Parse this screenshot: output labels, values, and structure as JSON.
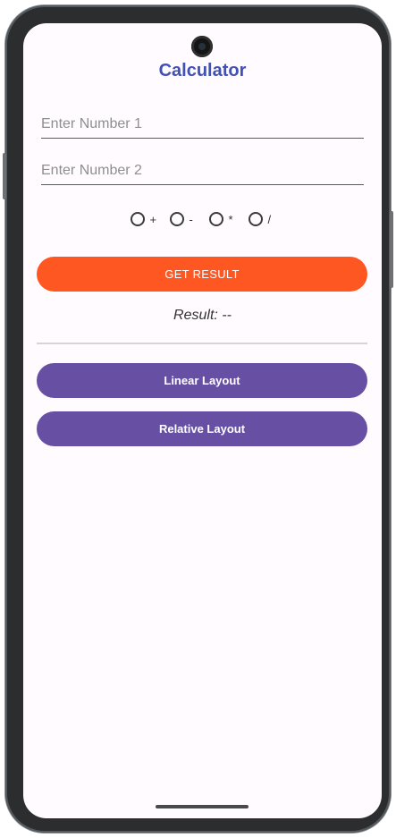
{
  "app": {
    "title": "Calculator"
  },
  "inputs": {
    "number1": {
      "placeholder": "Enter Number 1",
      "value": ""
    },
    "number2": {
      "placeholder": "Enter Number 2",
      "value": ""
    }
  },
  "operations": [
    {
      "label": "+",
      "selected": false
    },
    {
      "label": "-",
      "selected": false
    },
    {
      "label": "*",
      "selected": false
    },
    {
      "label": "/",
      "selected": false
    }
  ],
  "buttons": {
    "get_result": "GET RESULT",
    "linear_layout": "Linear Layout",
    "relative_layout": "Relative Layout"
  },
  "result": {
    "text": "Result: --"
  },
  "colors": {
    "title": "#3f51b5",
    "get_result_button": "#ff5722",
    "layout_buttons": "#6750a4",
    "screen_background": "#fffbfe"
  }
}
